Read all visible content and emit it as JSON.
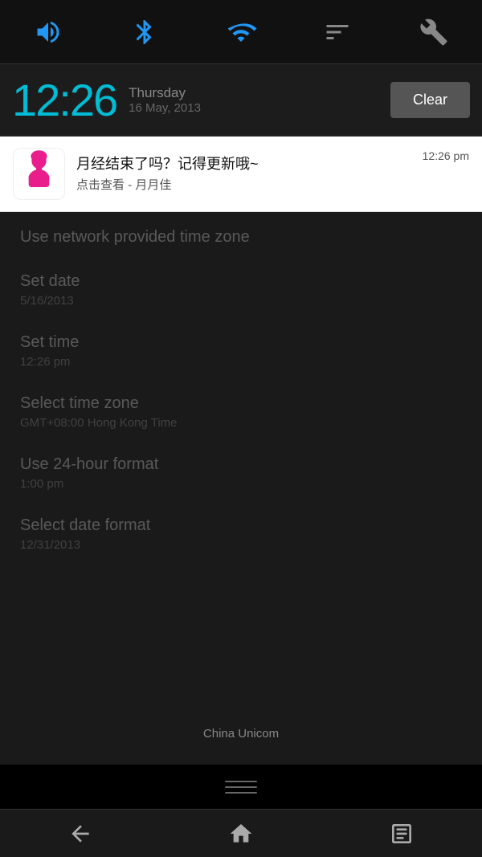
{
  "statusBar": {
    "icons": [
      "volume",
      "bluetooth",
      "wifi",
      "filter",
      "tools"
    ]
  },
  "notificationHeader": {
    "time": "12:26",
    "dayName": "Thursday",
    "dateFull": "16 May, 2013",
    "clearLabel": "Clear"
  },
  "notification": {
    "title": "月经结束了吗？记得更新哦~",
    "subtitle": "点击查看 - 月月佳",
    "time": "12:26 pm"
  },
  "settings": [
    {
      "label": "Use network provided time zone",
      "value": ""
    },
    {
      "label": "Set date",
      "value": "5/16/2013"
    },
    {
      "label": "Set time",
      "value": "12:26 pm"
    },
    {
      "label": "Select time zone",
      "value": "GMT+08:00 Hong Kong Time"
    },
    {
      "label": "Use 24-hour format",
      "value": "1:00 pm"
    },
    {
      "label": "Select date format",
      "value": "12/31/2013"
    }
  ],
  "carrier": "China Unicom",
  "nav": {
    "back": "←",
    "home": "⌂",
    "recents": "▭"
  }
}
